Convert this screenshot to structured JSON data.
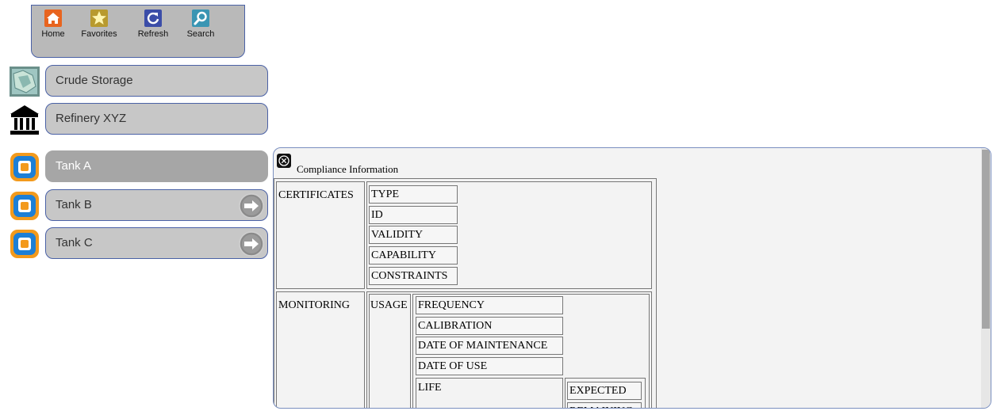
{
  "toolbar": {
    "items": [
      {
        "label": "Home",
        "icon": "home-icon"
      },
      {
        "label": "Favorites",
        "icon": "star-icon"
      },
      {
        "label": "Refresh",
        "icon": "refresh-icon"
      },
      {
        "label": "Search",
        "icon": "search-icon"
      }
    ]
  },
  "nav": {
    "crude_storage": "Crude Storage",
    "refinery": "Refinery XYZ",
    "tanks": [
      "Tank A",
      "Tank B",
      "Tank C"
    ]
  },
  "panel": {
    "title": "Compliance Information",
    "certificates": {
      "label": "CERTIFICATES",
      "fields": [
        "TYPE",
        "ID",
        "VALIDITY",
        "CAPABILITY",
        "CONSTRAINTS"
      ]
    },
    "monitoring": {
      "label": "MONITORING",
      "usage_label": "USAGE",
      "fields": [
        "FREQUENCY",
        "CALIBRATION",
        "DATE OF MAINTENANCE",
        "DATE OF USE"
      ],
      "life_label": "LIFE",
      "life_fields": [
        "EXPECTED",
        "REMAINING"
      ]
    }
  },
  "colors": {
    "toolbar_bg": "#b9b9b9",
    "pill_bg": "#c7c7c7",
    "pill_active_bg": "#a6a6a6",
    "border_accent": "#4a61a6"
  }
}
